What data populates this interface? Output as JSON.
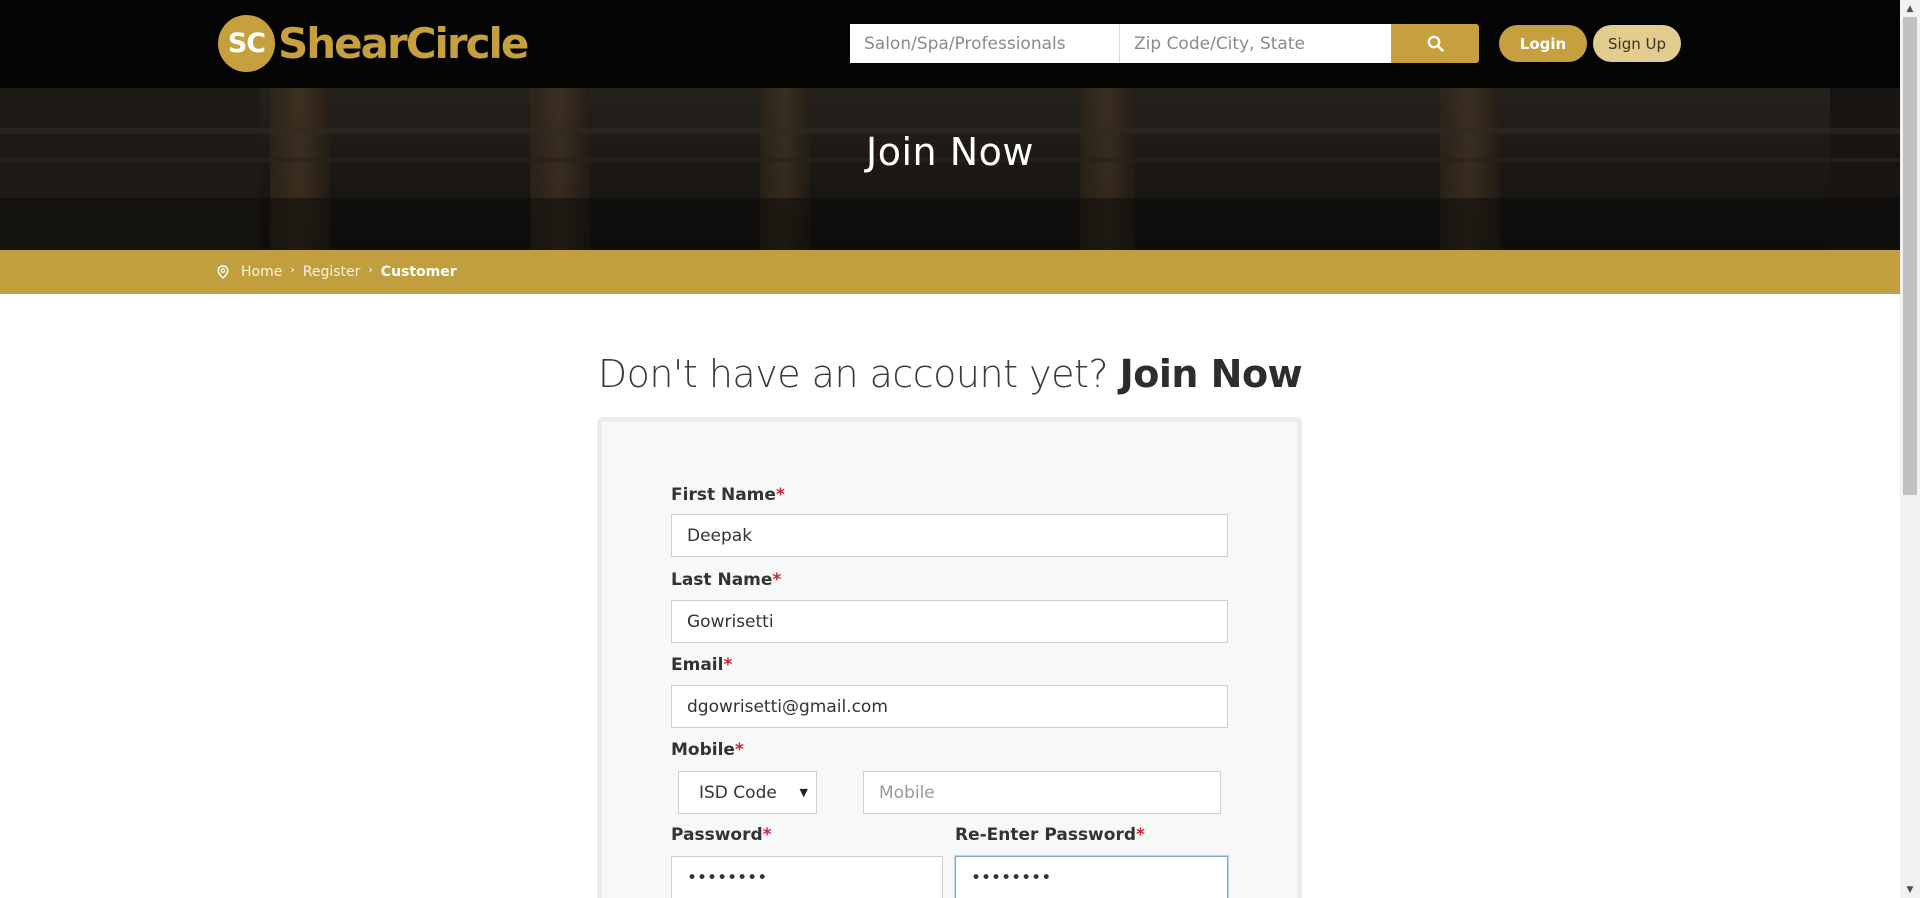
{
  "brand": {
    "badge": "SC",
    "name": "ShearCircle",
    "accent": "#c6a03e"
  },
  "header": {
    "search_business_placeholder": "Salon/Spa/Professionals",
    "search_location_placeholder": "Zip Code/City, State",
    "search_icon": "search-icon",
    "login_label": "Login",
    "signup_label": "Sign Up"
  },
  "hero": {
    "title": "Join Now"
  },
  "breadcrumb": {
    "icon": "location-pin-icon",
    "items": [
      "Home",
      "Register",
      "Customer"
    ]
  },
  "form": {
    "heading_light": "Don't have an account yet? ",
    "heading_bold": "Join Now",
    "required_mark": "*",
    "first_name": {
      "label": "First Name",
      "value": "Deepak"
    },
    "last_name": {
      "label": "Last Name",
      "value": "Gowrisetti"
    },
    "email": {
      "label": "Email",
      "value": "dgowrisetti@gmail.com"
    },
    "mobile": {
      "label": "Mobile",
      "isd_selected": "ISD Code",
      "placeholder": "Mobile",
      "value": ""
    },
    "password": {
      "label": "Password",
      "value": "Password"
    },
    "reenter_password": {
      "label": "Re-Enter Password",
      "value": "Password"
    }
  }
}
